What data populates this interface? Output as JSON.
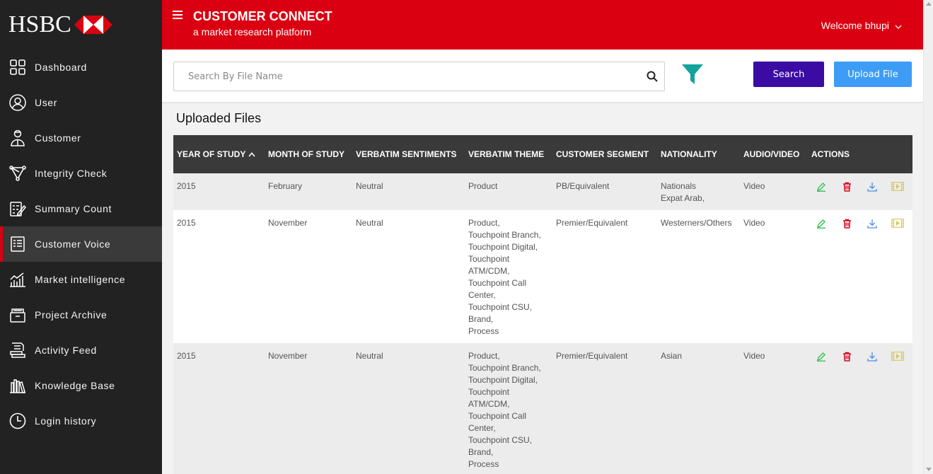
{
  "brand": {
    "name": "HSBC"
  },
  "header": {
    "title": "CUSTOMER CONNECT",
    "subtitle": "a market research platform",
    "welcome": "Welcome bhupi"
  },
  "sidebar": {
    "items": [
      {
        "label": "Dashboard",
        "icon": "dashboard-icon"
      },
      {
        "label": "User",
        "icon": "user-icon"
      },
      {
        "label": "Customer",
        "icon": "customer-icon"
      },
      {
        "label": "Integrity Check",
        "icon": "integrity-icon"
      },
      {
        "label": "Summary Count",
        "icon": "summary-icon"
      },
      {
        "label": "Customer Voice",
        "icon": "voice-icon",
        "active": true
      },
      {
        "label": "Market intelligence",
        "icon": "market-icon"
      },
      {
        "label": "Project Archive",
        "icon": "archive-icon"
      },
      {
        "label": "Activity Feed",
        "icon": "activity-icon"
      },
      {
        "label": "Knowledge Base",
        "icon": "knowledge-icon"
      },
      {
        "label": "Login history",
        "icon": "clock-icon"
      }
    ]
  },
  "search": {
    "placeholder": "Search By File Name",
    "search_label": "Search",
    "upload_label": "Upload File"
  },
  "main": {
    "section_title": "Uploaded Files"
  },
  "table": {
    "columns": [
      "YEAR OF STUDY",
      "MONTH OF STUDY",
      "VERBATIM SENTIMENTS",
      "VERBATIM THEME",
      "CUSTOMER SEGMENT",
      "NATIONALITY",
      "AUDIO/VIDEO",
      "ACTIONS"
    ],
    "rows": [
      {
        "year": "2015",
        "month": "February",
        "sentiment": "Neutral",
        "theme": [
          "Product"
        ],
        "segment": "PB/Equivalent",
        "nationality": [
          "Nationals",
          "Expat Arab,"
        ],
        "media": "Video"
      },
      {
        "year": "2015",
        "month": "November",
        "sentiment": "Neutral",
        "theme": [
          "Product,",
          "Touchpoint Branch,",
          "Touchpoint Digital,",
          "Touchpoint",
          "ATM/CDM,",
          "Touchpoint Call",
          "Center,",
          "Touchpoint CSU,",
          "Brand,",
          "Process"
        ],
        "segment": "Premier/Equivalent",
        "nationality": [
          "Westerners/Others"
        ],
        "media": "Video"
      },
      {
        "year": "2015",
        "month": "November",
        "sentiment": "Neutral",
        "theme": [
          "Product,",
          "Touchpoint Branch,",
          "Touchpoint Digital,",
          "Touchpoint",
          "ATM/CDM,",
          "Touchpoint Call",
          "Center,",
          "Touchpoint CSU,",
          "Brand,",
          "Process"
        ],
        "segment": "Premier/Equivalent",
        "nationality": [
          "Asian"
        ],
        "media": "Video"
      }
    ]
  },
  "colors": {
    "brand_red": "#db0011",
    "sidebar_bg": "#222222",
    "search_button": "#3a0ca3",
    "upload_button": "#3d9cf5",
    "filter_icon": "#14a39a",
    "edit_icon": "#2ebd4e",
    "delete_icon": "#d9001b",
    "download_icon": "#4a90e2",
    "video_icon": "#d8c75a"
  }
}
